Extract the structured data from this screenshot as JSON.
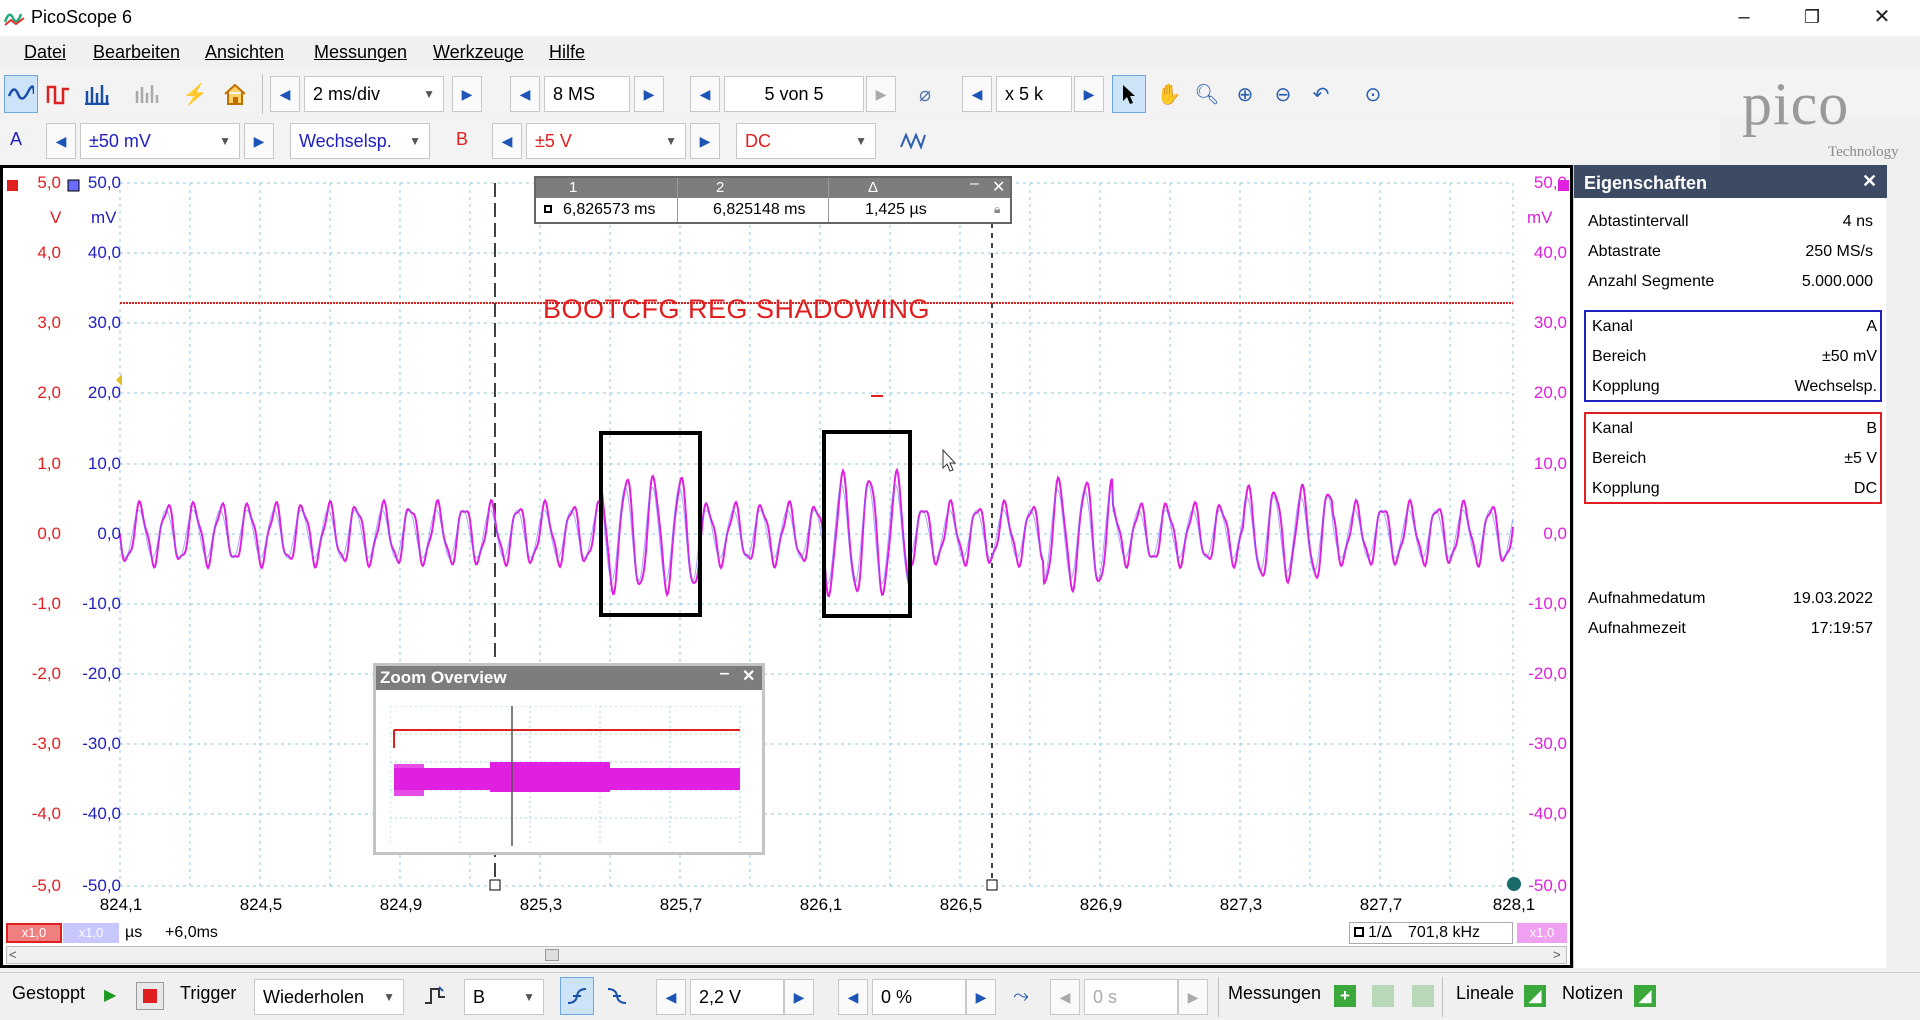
{
  "window": {
    "title": "PicoScope 6",
    "minimize": "–",
    "maximize": "❐",
    "close": "✕"
  },
  "menu": [
    "Datei",
    "Bearbeiten",
    "Ansichten",
    "Messungen",
    "Werkzeuge",
    "Hilfe"
  ],
  "toolbar": {
    "timebase": "2 ms/div",
    "samples": "8 MS",
    "buffer": "5 von 5",
    "zoom": "x 5 k"
  },
  "channel_a": {
    "label": "A",
    "range": "±50 mV",
    "coupling": "Wechselsp.",
    "color": "#2020c0"
  },
  "channel_b": {
    "label": "B",
    "range": "±5 V",
    "coupling": "DC",
    "color": "#e02020"
  },
  "logo": {
    "text": "pico",
    "sub": "Technology"
  },
  "plot": {
    "left_units_b": "V",
    "left_units_a": "mV",
    "right_units": "mV",
    "b_ticks": [
      "5,0",
      "4,0",
      "3,0",
      "2,0",
      "1,0",
      "0,0",
      "-1,0",
      "-2,0",
      "-3,0",
      "-4,0",
      "-5,0"
    ],
    "a_ticks": [
      "50,0",
      "40,0",
      "30,0",
      "20,0",
      "10,0",
      "0,0",
      "-10,0",
      "-20,0",
      "-30,0",
      "-40,0",
      "-50,0"
    ],
    "x_ticks": [
      "824,1",
      "824,5",
      "824,9",
      "825,3",
      "825,7",
      "826,1",
      "826,5",
      "826,9",
      "827,3",
      "827,7",
      "828,1"
    ],
    "x_unit": "µs",
    "x_offset": "+6,0ms",
    "scale_a": "x1,0",
    "scale_b": "x1,0",
    "scale_right": "x1,0",
    "annotation": "BOOTCFG REG SHADOWING",
    "freq_label": "1/Δ",
    "freq_value": "701,8 kHz"
  },
  "ruler_table": {
    "headers": [
      "1",
      "2",
      "Δ"
    ],
    "values": [
      "6,826573 ms",
      "6,825148 ms",
      "1,425 µs"
    ]
  },
  "zoom_overview": {
    "title": "Zoom Overview"
  },
  "properties": {
    "title": "Eigenschaften",
    "general": [
      {
        "k": "Abtastintervall",
        "v": "4 ns"
      },
      {
        "k": "Abtastrate",
        "v": "250 MS/s"
      },
      {
        "k": "Anzahl Segmente",
        "v": "5.000.000"
      }
    ],
    "chan_a": [
      {
        "k": "Kanal",
        "v": "A"
      },
      {
        "k": "Bereich",
        "v": "±50 mV"
      },
      {
        "k": "Kopplung",
        "v": "Wechselsp."
      }
    ],
    "chan_b": [
      {
        "k": "Kanal",
        "v": "B"
      },
      {
        "k": "Bereich",
        "v": "±5 V"
      },
      {
        "k": "Kopplung",
        "v": "DC"
      }
    ],
    "capture": [
      {
        "k": "Aufnahmedatum",
        "v": "19.03.2022"
      },
      {
        "k": "Aufnahmezeit",
        "v": "17:19:57"
      }
    ]
  },
  "status": {
    "state": "Gestoppt",
    "trigger_label": "Trigger",
    "trigger_mode": "Wiederholen",
    "trigger_source": "B",
    "trigger_level": "2,2 V",
    "pretrigger": "0 %",
    "delay": "0 s",
    "measurements": "Messungen",
    "rulers": "Lineale",
    "notes": "Notizen"
  }
}
